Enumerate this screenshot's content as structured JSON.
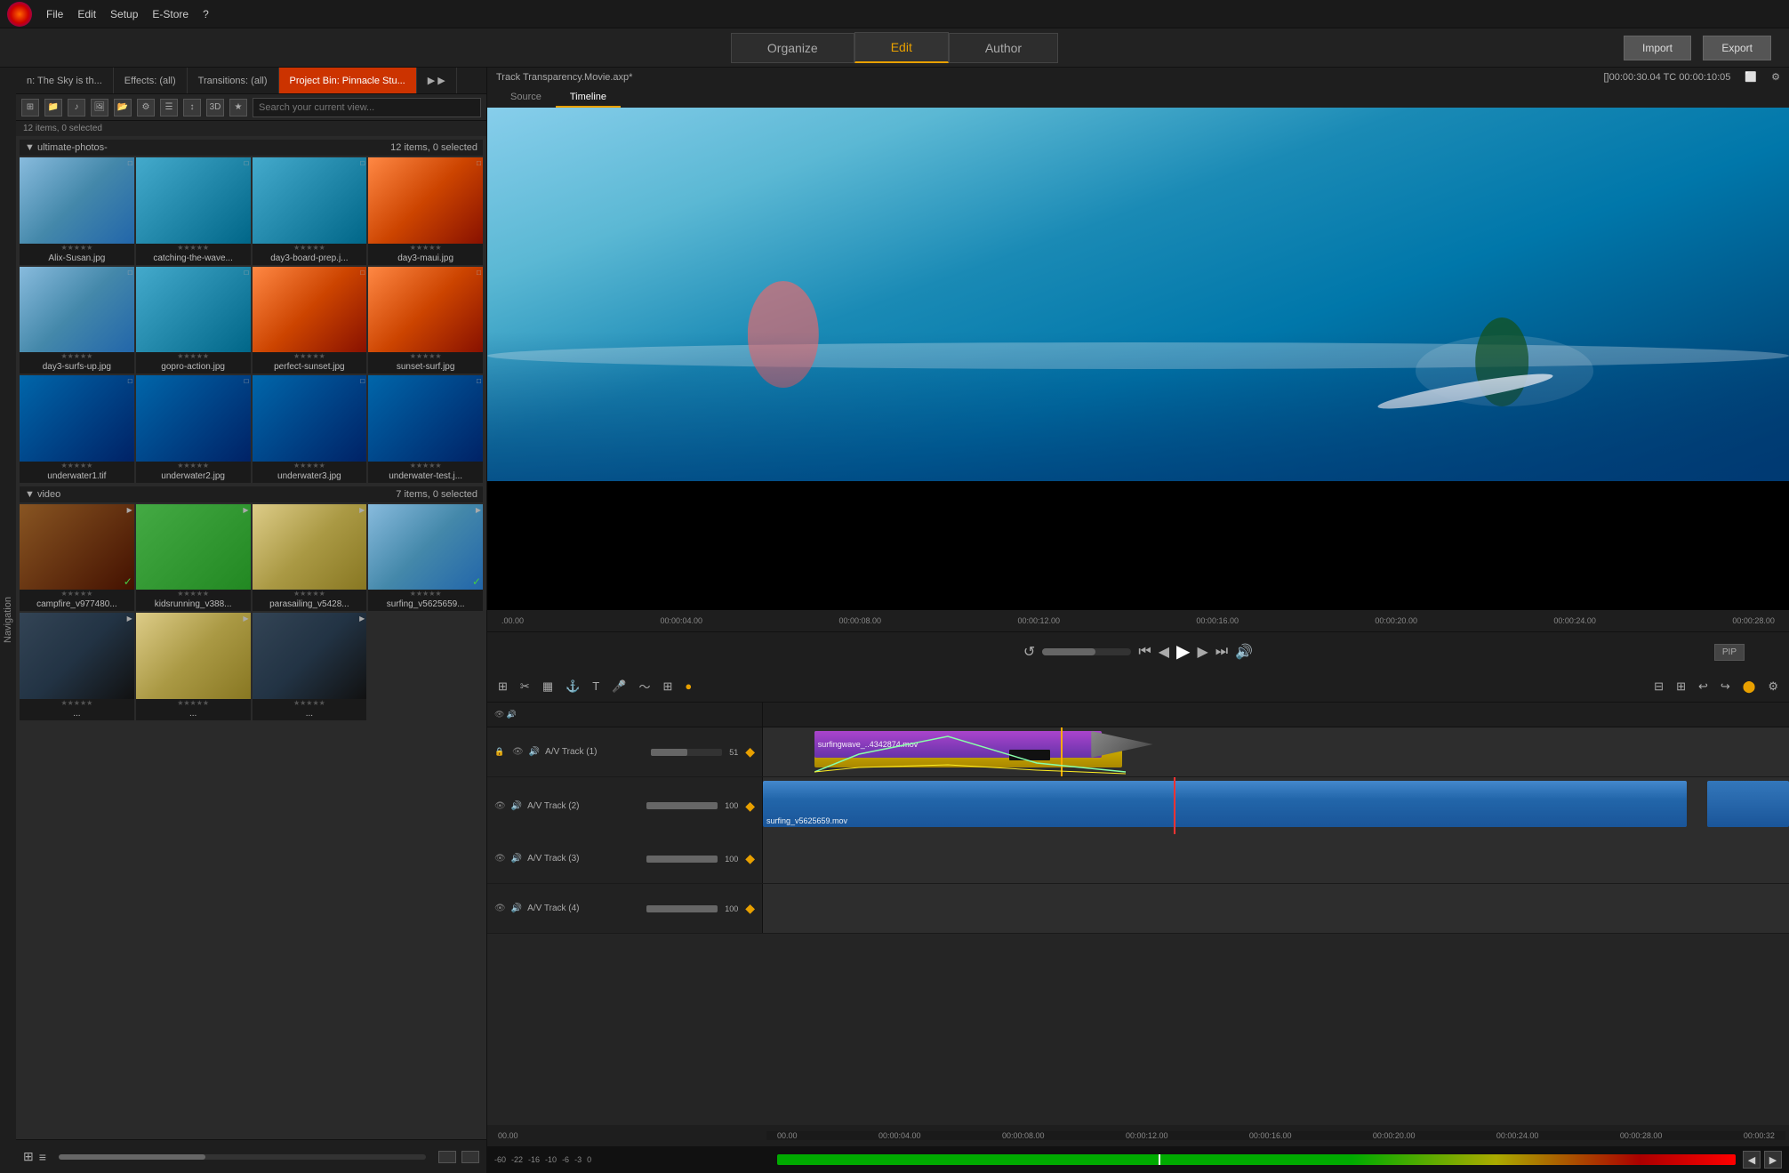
{
  "app": {
    "logo_alt": "Pinnacle Studio Logo"
  },
  "menu": {
    "file": "File",
    "edit": "Edit",
    "setup": "Setup",
    "estore": "E-Store",
    "help": "?"
  },
  "nav": {
    "organize": "Organize",
    "edit": "Edit",
    "author": "Author",
    "import": "Import",
    "export": "Export"
  },
  "panel_tabs": {
    "tab1": "n: The Sky is th...",
    "tab2": "Effects: (all)",
    "tab3": "Transitions: (all)",
    "tab4": "Project Bin: Pinnacle Stu...",
    "close": "×"
  },
  "toolbar": {
    "search_placeholder": "Search your current view..."
  },
  "items_header": {
    "photos": "12 items, 0 selected",
    "videos": "7 items, 0 selected"
  },
  "sections": {
    "photos": "ultimate-photos-",
    "videos": "video"
  },
  "media_items": {
    "photos": [
      {
        "name": "Alix-Susan.jpg",
        "thumb_class": "thumb-surf1"
      },
      {
        "name": "catching-the-wave...",
        "thumb_class": "thumb-surf2"
      },
      {
        "name": "day3-board-prep.j...",
        "thumb_class": "thumb-surf2"
      },
      {
        "name": "day3-maui.jpg",
        "thumb_class": "thumb-sunset"
      },
      {
        "name": "day3-surfs-up.jpg",
        "thumb_class": "thumb-surf1"
      },
      {
        "name": "gopro-action.jpg",
        "thumb_class": "thumb-surf2"
      },
      {
        "name": "perfect-sunset.jpg",
        "thumb_class": "thumb-sunset"
      },
      {
        "name": "sunset-surf.jpg",
        "thumb_class": "thumb-sunset"
      },
      {
        "name": "underwater1.tif",
        "thumb_class": "thumb-underwater"
      },
      {
        "name": "underwater2.jpg",
        "thumb_class": "thumb-underwater"
      },
      {
        "name": "underwater3.jpg",
        "thumb_class": "thumb-underwater"
      },
      {
        "name": "underwater-test.j...",
        "thumb_class": "thumb-underwater"
      }
    ],
    "videos": [
      {
        "name": "campfire_v977480...",
        "thumb_class": "thumb-camp",
        "has_check": true
      },
      {
        "name": "kidsrunning_v388...",
        "thumb_class": "thumb-green"
      },
      {
        "name": "parasailing_v5428...",
        "thumb_class": "thumb-beach"
      },
      {
        "name": "surfing_v5625659...",
        "thumb_class": "thumb-surf1",
        "has_check": true
      },
      {
        "name": "...",
        "thumb_class": "thumb-video"
      },
      {
        "name": "...",
        "thumb_class": "thumb-beach"
      },
      {
        "name": "...",
        "thumb_class": "thumb-video"
      }
    ]
  },
  "preview": {
    "title": "Track Transparency.Movie.axp*",
    "timecode": "[]00:00:30.04  TC 00:00:10:05",
    "source_tab": "Source",
    "timeline_tab": "Timeline",
    "pip": "PIP"
  },
  "timeline_ruler": {
    "marks": [
      "00.00",
      "00:00:04.00",
      "00:00:08.00",
      "00:00:12.00",
      "00:00:16.00",
      "00:00:20.00",
      "00:00:24.00",
      "00:00:28.00"
    ]
  },
  "tracks": [
    {
      "name": "A/V Track (1)",
      "volume": "51",
      "volume_pct": 51
    },
    {
      "name": "A/V Track (2)",
      "volume": "100",
      "volume_pct": 100
    },
    {
      "name": "A/V Track (3)",
      "volume": "100",
      "volume_pct": 100
    },
    {
      "name": "A/V Track (4)",
      "volume": "100",
      "volume_pct": 100
    }
  ],
  "clips": {
    "track1_clip1": "surfingwave_..4342874.mov",
    "track2_clip1": "surfing_v5625659.mov"
  },
  "bottom_ruler": {
    "marks": [
      "00.00",
      "00:00:04.00",
      "00:00:08.00",
      "00:00:12.00",
      "00:00:16.00",
      "00:00:20.00",
      "00:00:24.00",
      "00:00:28.00",
      "00:00:32"
    ]
  },
  "level_meter": {
    "labels": [
      "-60",
      "-22",
      "-16",
      "-10",
      "-6",
      "-3",
      "0"
    ]
  }
}
